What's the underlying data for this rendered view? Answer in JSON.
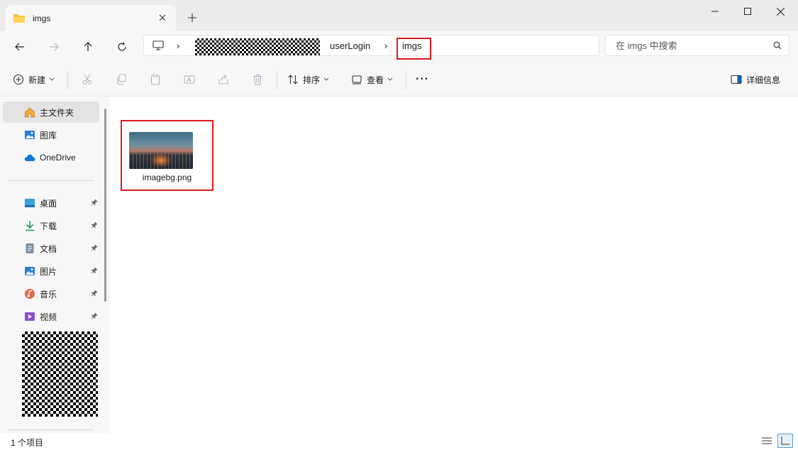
{
  "tab": {
    "title": "imgs",
    "new_tab_symbol": "+"
  },
  "window_controls": {
    "minimize": "─",
    "maximize": "☐",
    "close": "✕"
  },
  "address_bar": {
    "segments": [
      "userLogin",
      "imgs"
    ],
    "separator": "›"
  },
  "search": {
    "placeholder": "在 imgs 中搜索"
  },
  "command_bar": {
    "new_label": "新建",
    "sort_label": "排序",
    "view_label": "查看",
    "more_label": "···",
    "details_label": "详细信息"
  },
  "sidebar": {
    "top_items": [
      {
        "label": "主文件夹",
        "icon": "home-icon"
      },
      {
        "label": "图库",
        "icon": "gallery-icon"
      },
      {
        "label": "OneDrive",
        "icon": "cloud-icon"
      }
    ],
    "quick_access": [
      {
        "label": "桌面",
        "icon": "desktop-icon"
      },
      {
        "label": "下载",
        "icon": "download-icon"
      },
      {
        "label": "文档",
        "icon": "document-icon"
      },
      {
        "label": "图片",
        "icon": "pictures-icon"
      },
      {
        "label": "音乐",
        "icon": "music-icon"
      },
      {
        "label": "视频",
        "icon": "video-icon"
      }
    ]
  },
  "files": [
    {
      "name": "imagebg.png"
    }
  ],
  "status": {
    "item_count": "1 个项目"
  },
  "colors": {
    "highlight": "#e0191b",
    "accent": "#0067c0",
    "folder": "#f4c03f"
  }
}
